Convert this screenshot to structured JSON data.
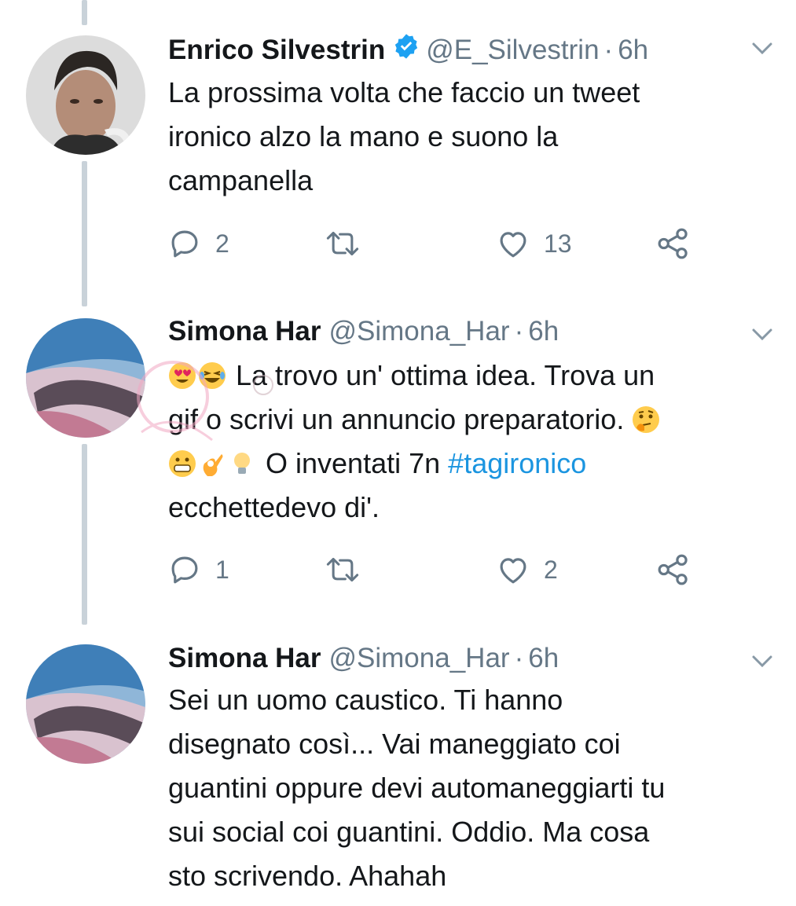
{
  "colors": {
    "text": "#14171a",
    "secondary": "#657786",
    "link": "#1b95e0",
    "verified": "#1da1f2",
    "thread_line": "#c9d2d9"
  },
  "tweets": [
    {
      "name": "Enrico Silvestrin",
      "verified": true,
      "handle": "@E_Silvestrin",
      "separator": "·",
      "time": "6h",
      "lines": [
        "La prossima volta che faccio un tweet",
        "ironico alzo la mano e suono la",
        "campanella"
      ],
      "reply_count": "2",
      "like_count": "13"
    },
    {
      "name": "Simona Har",
      "verified": false,
      "handle": "@Simona_Har",
      "separator": "·",
      "time": "6h",
      "line1_text": "La trovo un' ottima idea. Trova un",
      "line2_text": "gif o scrivi un annuncio preparatorio.",
      "line3_text": "O inventati 7n",
      "hashtag": "#tagironico",
      "line4_text": "ecchettedevo di'.",
      "emojis": [
        "heart-eyes-emoji",
        "laughing-emoji",
        "thinking-emoji",
        "grinning-emoji",
        "ok-hand-emoji",
        "light-bulb-emoji"
      ],
      "reply_count": "1",
      "like_count": "2"
    },
    {
      "name": "Simona Har",
      "verified": false,
      "handle": "@Simona_Har",
      "separator": "·",
      "time": "6h",
      "lines": [
        "Sei un uomo caustico. Ti hanno",
        "disegnato così... Vai maneggiato coi",
        "guantini oppure devi automaneggiarti tu",
        "sui social coi guantini. Oddio. Ma cosa",
        "sto scrivendo. Ahahah"
      ]
    }
  ],
  "icons": {
    "reply": "reply-icon",
    "retweet": "retweet-icon",
    "like": "heart-icon",
    "share": "share-icon",
    "caret": "chevron-down-icon",
    "verified": "verified-badge-icon"
  }
}
